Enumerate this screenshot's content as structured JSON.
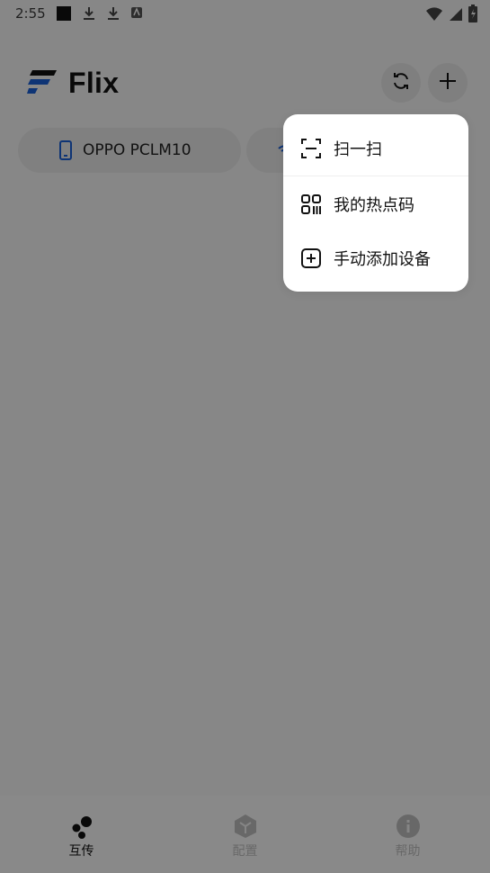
{
  "status_bar": {
    "time": "2:55"
  },
  "app": {
    "title": "Flix"
  },
  "chips": [
    {
      "label": "OPPO PCLM10"
    }
  ],
  "menu": {
    "items": [
      {
        "label": "扫一扫"
      },
      {
        "label": "我的热点码"
      },
      {
        "label": "手动添加设备"
      }
    ]
  },
  "bottom_nav": {
    "items": [
      {
        "label": "互传",
        "active": true
      },
      {
        "label": "配置",
        "active": false
      },
      {
        "label": "帮助",
        "active": false
      }
    ]
  },
  "colors": {
    "accent": "#1b5fd6",
    "scrim": "rgba(0,0,0,0.45)",
    "nav_active": "#111111",
    "nav_inactive": "#bdbdbd"
  }
}
